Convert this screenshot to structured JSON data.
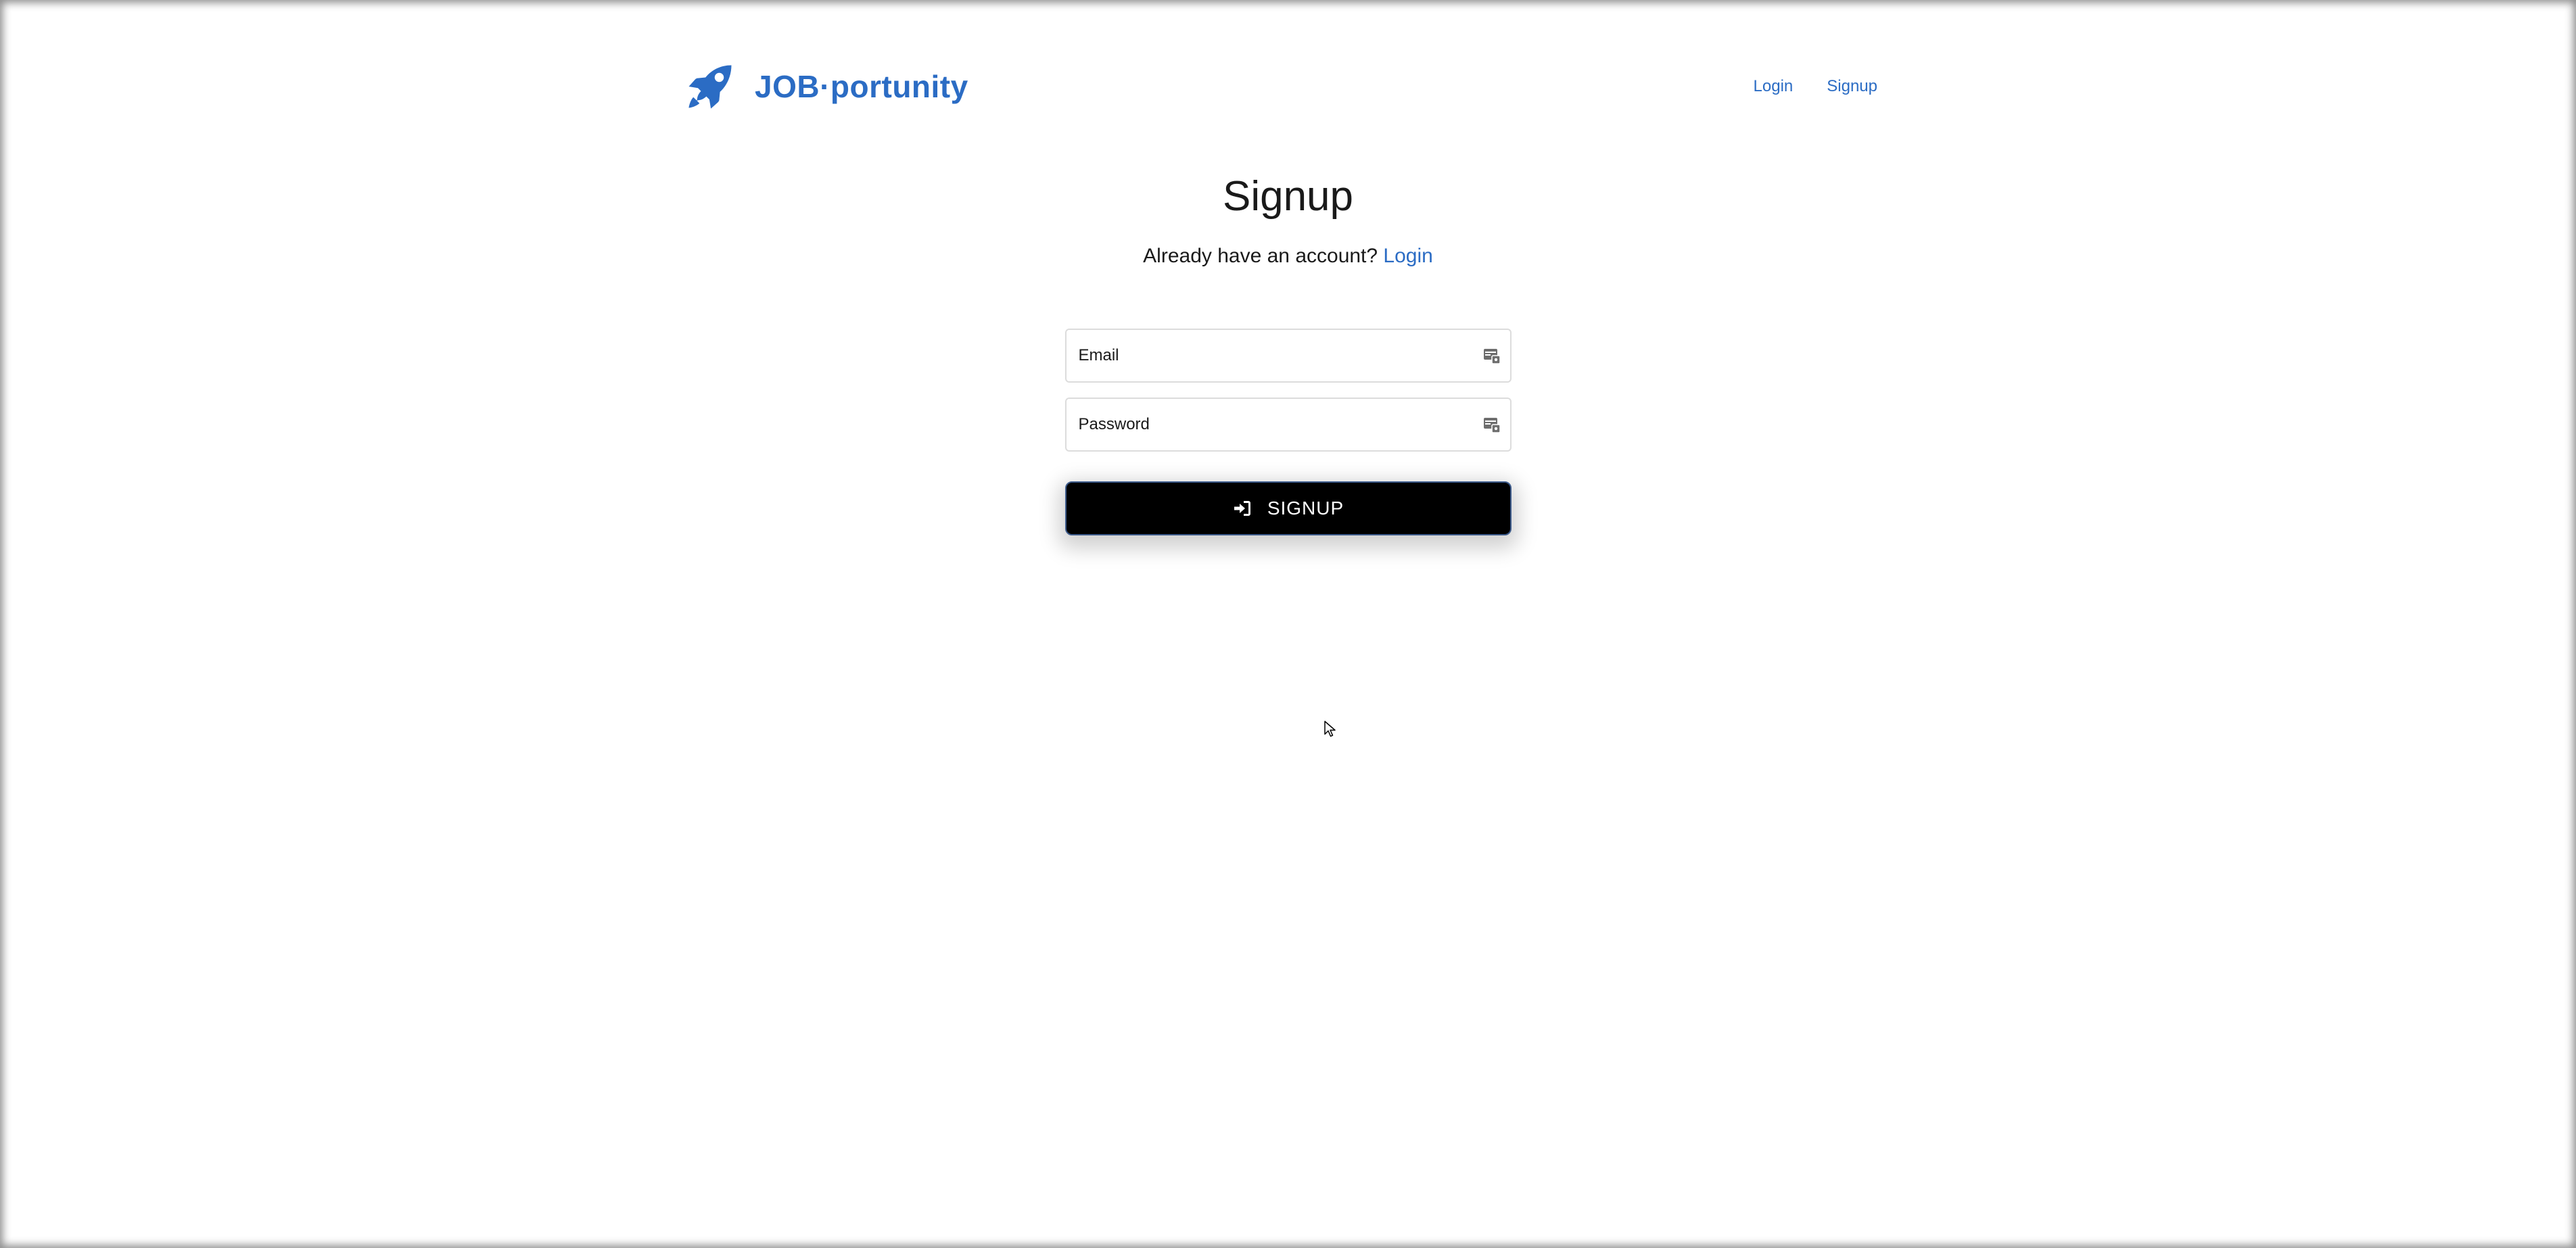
{
  "brand": {
    "name": "JOB·portunity",
    "icon": "rocket-icon",
    "color": "#2b6cc4"
  },
  "nav": {
    "login_label": "Login",
    "signup_label": "Signup"
  },
  "page": {
    "title": "Signup",
    "subtitle_text": "Already have an account? ",
    "subtitle_link": "Login"
  },
  "form": {
    "email_placeholder": "Email",
    "password_placeholder": "Password",
    "field_icon": "password-manager-icon",
    "submit_label": "SIGNUP",
    "submit_icon": "sign-in-icon",
    "submit_bg": "#000000"
  }
}
